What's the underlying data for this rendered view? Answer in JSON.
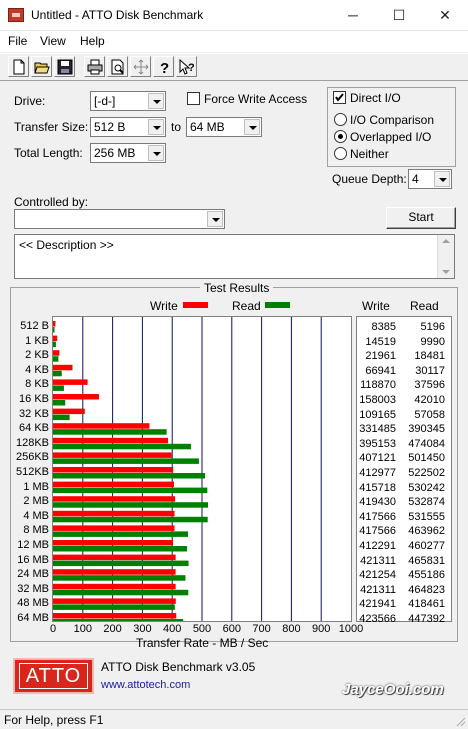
{
  "window": {
    "title": "Untitled - ATTO Disk Benchmark",
    "minimize": "─",
    "maximize": "☐",
    "close": "✕"
  },
  "menu": [
    "File",
    "View",
    "Help"
  ],
  "toolbar": [
    "new-icon",
    "open-icon",
    "save-icon",
    "print-icon",
    "print-preview-icon",
    "move-icon",
    "help-icon",
    "context-help-icon"
  ],
  "form": {
    "drive_label": "Drive:",
    "drive_value": "[-d-]",
    "transfer_size_label": "Transfer Size:",
    "transfer_from": "512 B",
    "to_label": "to",
    "transfer_to": "64 MB",
    "total_length_label": "Total Length:",
    "total_length_value": "256 MB",
    "force_write_label": "Force Write Access",
    "force_write_checked": false,
    "direct_io_label": "Direct I/O",
    "direct_io_checked": true,
    "io_comparison_label": "I/O Comparison",
    "overlapped_io_label": "Overlapped I/O",
    "neither_label": "Neither",
    "selected_mode": "Overlapped I/O",
    "queue_depth_label": "Queue Depth:",
    "queue_depth_value": "4",
    "controlled_by_label": "Controlled by:",
    "controlled_by_value": "",
    "start_label": "Start",
    "description": "<< Description >>"
  },
  "results": {
    "title": "Test Results",
    "legend_write": "Write",
    "legend_read": "Read",
    "col_write": "Write",
    "col_read": "Read",
    "write_color": "#ff0000",
    "read_color": "#008000"
  },
  "chart_data": {
    "type": "bar",
    "title": "Test Results",
    "xlabel": "Transfer Rate - MB / Sec",
    "xlim": [
      0,
      1000
    ],
    "xticks": [
      "0",
      "100",
      "200",
      "300",
      "400",
      "500",
      "600",
      "700",
      "800",
      "900",
      "1000"
    ],
    "categories": [
      "512 B",
      "1 KB",
      "2 KB",
      "4 KB",
      "8 KB",
      "16 KB",
      "32 KB",
      "64 KB",
      "128KB",
      "256KB",
      "512KB",
      "1 MB",
      "2 MB",
      "4 MB",
      "8 MB",
      "12 MB",
      "16 MB",
      "24 MB",
      "32 MB",
      "48 MB",
      "64 MB"
    ],
    "series": [
      {
        "name": "Write",
        "color": "#ff0000",
        "values": [
          8385,
          14519,
          21961,
          66941,
          118870,
          158003,
          109165,
          331485,
          395153,
          407121,
          412977,
          415718,
          419430,
          417566,
          417566,
          412291,
          421311,
          421254,
          421311,
          421941,
          423566
        ]
      },
      {
        "name": "Read",
        "color": "#008000",
        "values": [
          5196,
          9990,
          18481,
          30117,
          37596,
          42010,
          57058,
          390345,
          474084,
          501450,
          522502,
          530242,
          532874,
          531555,
          463962,
          460277,
          465831,
          455186,
          464823,
          418461,
          447392
        ]
      }
    ]
  },
  "footer": {
    "logo_text": "ATTO",
    "app_version": "ATTO Disk Benchmark v3.05",
    "website": "www.attotech.com",
    "watermark": "JayceOoi.com"
  },
  "status": "For Help, press F1"
}
